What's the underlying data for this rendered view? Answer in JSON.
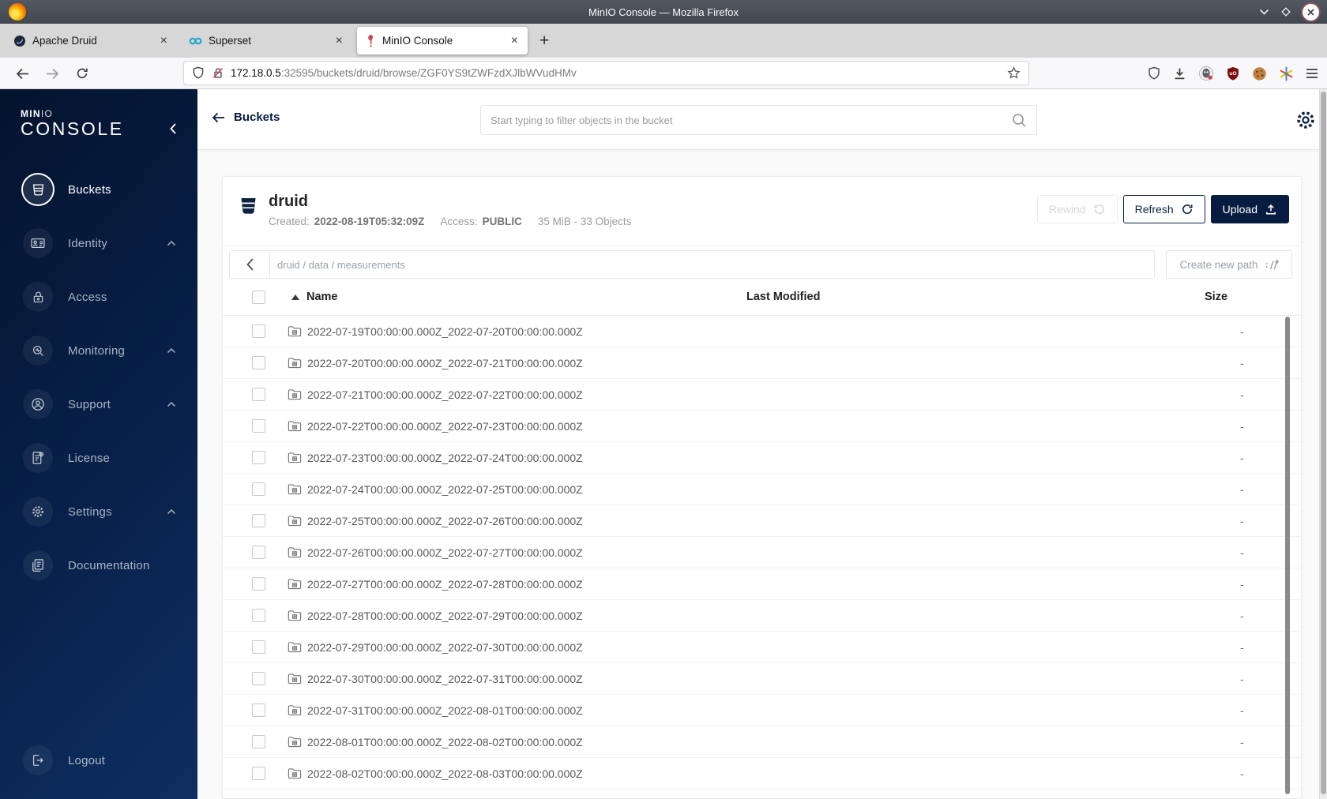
{
  "window": {
    "title": "MinIO Console — Mozilla Firefox"
  },
  "tabs": {
    "close_glyph": "×",
    "new_tab": "+",
    "items": [
      {
        "label": "Apache Druid"
      },
      {
        "label": "Superset"
      },
      {
        "label": "MinIO Console"
      }
    ]
  },
  "navbar": {
    "url_host": "172.18.0.5",
    "url_rest": ":32595/buckets/druid/browse/ZGF0YS9tZWFzdXJlbWVudHMv"
  },
  "sidebar": {
    "logo_min": "MIN",
    "logo_io": "IO",
    "logo_console": "CONSOLE",
    "items": [
      {
        "label": "Buckets"
      },
      {
        "label": "Identity"
      },
      {
        "label": "Access"
      },
      {
        "label": "Monitoring"
      },
      {
        "label": "Support"
      },
      {
        "label": "License"
      },
      {
        "label": "Settings"
      },
      {
        "label": "Documentation"
      }
    ],
    "logout_label": "Logout"
  },
  "header": {
    "back_label": "Buckets",
    "search_placeholder": "Start typing to filter objects in the bucket"
  },
  "bucket": {
    "name": "druid",
    "created_label": "Created:",
    "created_value": "2022-08-19T05:32:09Z",
    "access_label": "Access:",
    "access_value": "PUBLIC",
    "usage": "35 MiB - 33 Objects",
    "rewind_label": "Rewind",
    "refresh_label": "Refresh",
    "upload_label": "Upload",
    "breadcrumb": "druid / data / measurements",
    "create_path_label": "Create new path"
  },
  "table": {
    "col_name": "Name",
    "col_modified": "Last Modified",
    "col_size": "Size",
    "rows": [
      {
        "name": "2022-07-19T00:00:00.000Z_2022-07-20T00:00:00.000Z",
        "size": "-"
      },
      {
        "name": "2022-07-20T00:00:00.000Z_2022-07-21T00:00:00.000Z",
        "size": "-"
      },
      {
        "name": "2022-07-21T00:00:00.000Z_2022-07-22T00:00:00.000Z",
        "size": "-"
      },
      {
        "name": "2022-07-22T00:00:00.000Z_2022-07-23T00:00:00.000Z",
        "size": "-"
      },
      {
        "name": "2022-07-23T00:00:00.000Z_2022-07-24T00:00:00.000Z",
        "size": "-"
      },
      {
        "name": "2022-07-24T00:00:00.000Z_2022-07-25T00:00:00.000Z",
        "size": "-"
      },
      {
        "name": "2022-07-25T00:00:00.000Z_2022-07-26T00:00:00.000Z",
        "size": "-"
      },
      {
        "name": "2022-07-26T00:00:00.000Z_2022-07-27T00:00:00.000Z",
        "size": "-"
      },
      {
        "name": "2022-07-27T00:00:00.000Z_2022-07-28T00:00:00.000Z",
        "size": "-"
      },
      {
        "name": "2022-07-28T00:00:00.000Z_2022-07-29T00:00:00.000Z",
        "size": "-"
      },
      {
        "name": "2022-07-29T00:00:00.000Z_2022-07-30T00:00:00.000Z",
        "size": "-"
      },
      {
        "name": "2022-07-30T00:00:00.000Z_2022-07-31T00:00:00.000Z",
        "size": "-"
      },
      {
        "name": "2022-07-31T00:00:00.000Z_2022-08-01T00:00:00.000Z",
        "size": "-"
      },
      {
        "name": "2022-08-01T00:00:00.000Z_2022-08-02T00:00:00.000Z",
        "size": "-"
      },
      {
        "name": "2022-08-02T00:00:00.000Z_2022-08-03T00:00:00.000Z",
        "size": "-"
      }
    ]
  },
  "colors": {
    "accent_navy": "#081C42",
    "flamingo_pink": "#CE4257",
    "superset_teal": "#20A7C9"
  }
}
